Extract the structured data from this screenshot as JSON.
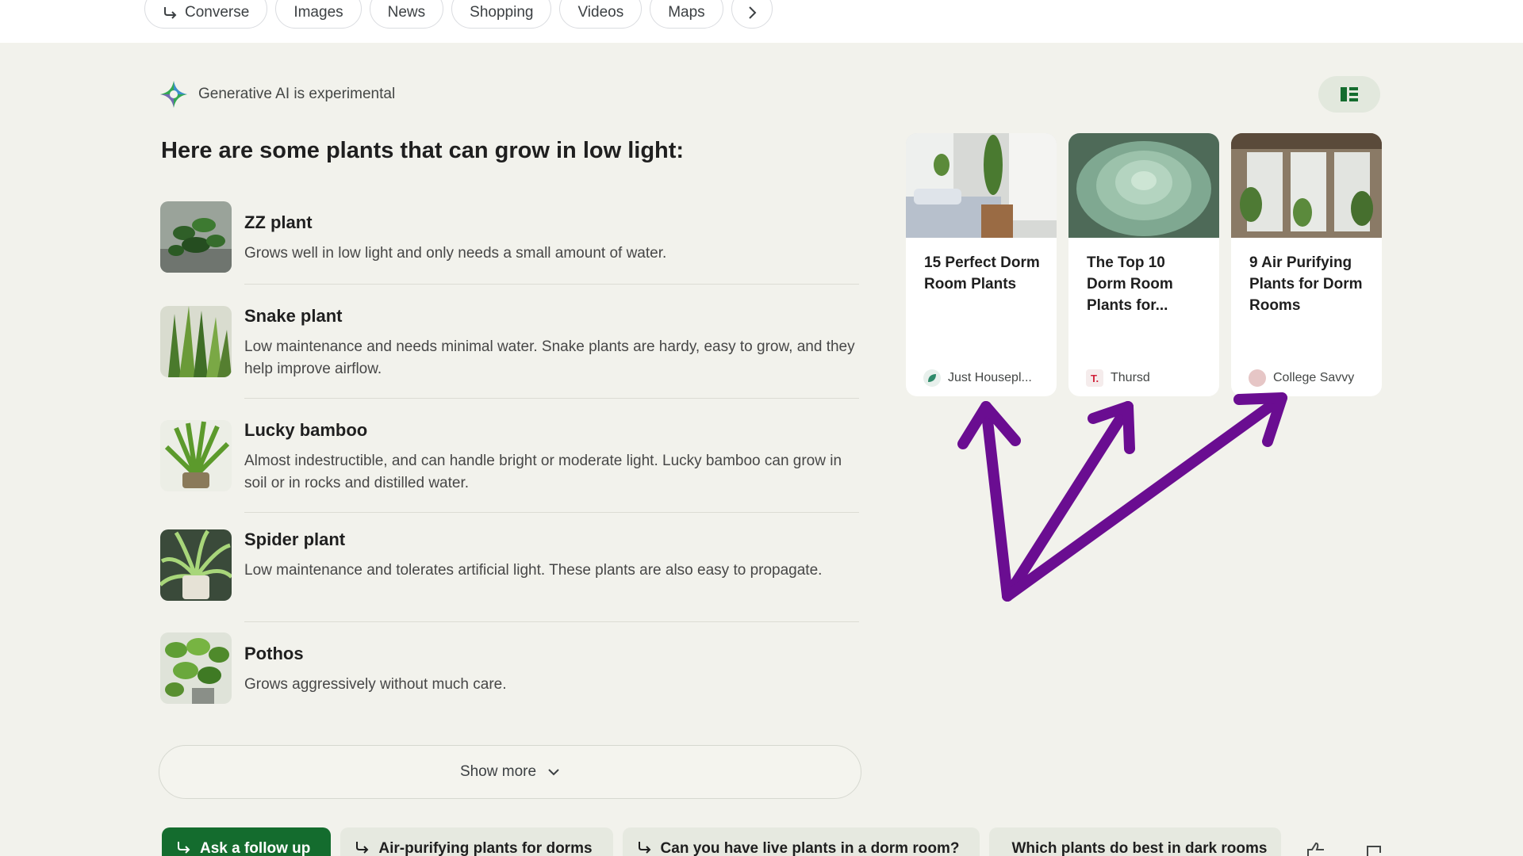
{
  "tabs": [
    {
      "label": "Converse",
      "icon": "follow-up-arrow-icon"
    },
    {
      "label": "Images"
    },
    {
      "label": "News"
    },
    {
      "label": "Shopping"
    },
    {
      "label": "Videos"
    },
    {
      "label": "Maps"
    }
  ],
  "ai": {
    "label": "Generative AI is experimental"
  },
  "headline": "Here are some plants that can grow in low light:",
  "plants": [
    {
      "name": "ZZ plant",
      "desc": "Grows well in low light and only needs a small amount of water."
    },
    {
      "name": "Snake plant",
      "desc": "Low maintenance and needs minimal water. Snake plants are hardy, easy to grow, and they help improve airflow."
    },
    {
      "name": "Lucky bamboo",
      "desc": "Almost indestructible, and can handle bright or moderate light. Lucky bamboo can grow in soil or in rocks and distilled water."
    },
    {
      "name": "Spider plant",
      "desc": "Low maintenance and tolerates artificial light. These plants are also easy to propagate."
    },
    {
      "name": "Pothos",
      "desc": "Grows aggressively without much care."
    }
  ],
  "show_more": "Show more",
  "cards": [
    {
      "title": "15 Perfect Dorm Room Plants",
      "source": "Just Housepl..."
    },
    {
      "title": "The Top 10 Dorm Room Plants for...",
      "source": "Thursd",
      "source_icon_letter": "T."
    },
    {
      "title": "9 Air Purifying Plants for Dorm Rooms",
      "source": "College Savvy"
    }
  ],
  "followups": [
    {
      "label": "Ask a follow up"
    },
    {
      "label": "Air-purifying plants for dorms"
    },
    {
      "label": "Can you have live plants in a dorm room?"
    },
    {
      "label": "Which plants do best in dark rooms"
    }
  ],
  "colors": {
    "background": "#f2f2ec",
    "primary_chip": "#146c2e",
    "annotation_arrows": "#6a0d91"
  }
}
